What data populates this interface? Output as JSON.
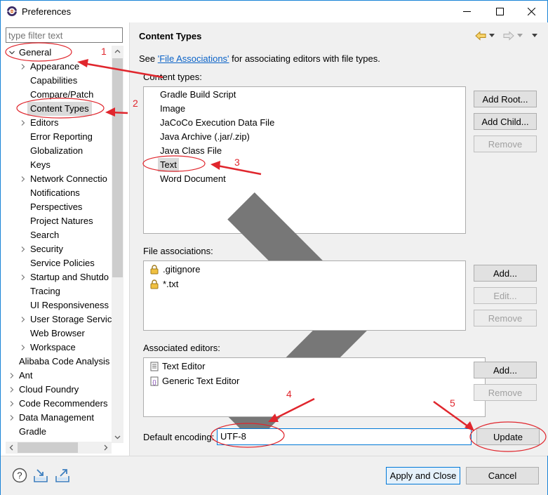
{
  "window": {
    "title": "Preferences",
    "controls": {
      "minimize": "minimize-icon",
      "maximize": "maximize-icon",
      "close": "close-icon"
    }
  },
  "filter": {
    "placeholder": "type filter text",
    "value": ""
  },
  "tree": {
    "items": [
      {
        "label": "General",
        "level": 0,
        "expander": "expanded"
      },
      {
        "label": "Appearance",
        "level": 1,
        "expander": "collapsed"
      },
      {
        "label": "Capabilities",
        "level": 1,
        "expander": "none"
      },
      {
        "label": "Compare/Patch",
        "level": 1,
        "expander": "none"
      },
      {
        "label": "Content Types",
        "level": 1,
        "expander": "none",
        "selected": true
      },
      {
        "label": "Editors",
        "level": 1,
        "expander": "collapsed"
      },
      {
        "label": "Error Reporting",
        "level": 1,
        "expander": "none"
      },
      {
        "label": "Globalization",
        "level": 1,
        "expander": "none"
      },
      {
        "label": "Keys",
        "level": 1,
        "expander": "none"
      },
      {
        "label": "Network Connectio",
        "level": 1,
        "expander": "collapsed"
      },
      {
        "label": "Notifications",
        "level": 1,
        "expander": "none"
      },
      {
        "label": "Perspectives",
        "level": 1,
        "expander": "none"
      },
      {
        "label": "Project Natures",
        "level": 1,
        "expander": "none"
      },
      {
        "label": "Search",
        "level": 1,
        "expander": "none"
      },
      {
        "label": "Security",
        "level": 1,
        "expander": "collapsed"
      },
      {
        "label": "Service Policies",
        "level": 1,
        "expander": "none"
      },
      {
        "label": "Startup and Shutdo",
        "level": 1,
        "expander": "collapsed"
      },
      {
        "label": "Tracing",
        "level": 1,
        "expander": "none"
      },
      {
        "label": "UI Responsiveness",
        "level": 1,
        "expander": "none"
      },
      {
        "label": "User Storage Servic",
        "level": 1,
        "expander": "collapsed"
      },
      {
        "label": "Web Browser",
        "level": 1,
        "expander": "none"
      },
      {
        "label": "Workspace",
        "level": 1,
        "expander": "collapsed"
      },
      {
        "label": "Alibaba Code Analysis",
        "level": 0,
        "expander": "none"
      },
      {
        "label": "Ant",
        "level": 0,
        "expander": "collapsed"
      },
      {
        "label": "Cloud Foundry",
        "level": 0,
        "expander": "collapsed"
      },
      {
        "label": "Code Recommenders",
        "level": 0,
        "expander": "collapsed"
      },
      {
        "label": "Data Management",
        "level": 0,
        "expander": "collapsed"
      },
      {
        "label": "Gradle",
        "level": 0,
        "expander": "none"
      }
    ]
  },
  "page": {
    "title": "Content Types",
    "desc_prefix": "See ",
    "desc_link": "'File Associations'",
    "desc_suffix": " for associating editors with file types.",
    "content_types_label": "Content types:",
    "content_types": [
      {
        "label": "Gradle Build Script",
        "expander": "none"
      },
      {
        "label": "Image",
        "expander": "none"
      },
      {
        "label": "JaCoCo Execution Data File",
        "expander": "none"
      },
      {
        "label": "Java Archive (.jar/.zip)",
        "expander": "none"
      },
      {
        "label": "Java Class File",
        "expander": "none"
      },
      {
        "label": "Text",
        "expander": "collapsed",
        "selected": true
      },
      {
        "label": "Word Document",
        "expander": "none"
      }
    ],
    "file_assoc_label": "File associations:",
    "file_associations": [
      {
        "label": ".gitignore",
        "icon": "lock-icon"
      },
      {
        "label": "*.txt",
        "icon": "lock-icon"
      }
    ],
    "editors_label": "Associated editors:",
    "editors": [
      {
        "label": "Text Editor",
        "icon": "text-editor-icon"
      },
      {
        "label": "Generic Text Editor",
        "icon": "generic-editor-icon"
      }
    ],
    "encoding_label": "Default encoding:",
    "encoding_value": "UTF-8",
    "buttons": {
      "add_root": "Add Root...",
      "add_child": "Add Child...",
      "remove1": "Remove",
      "add_assoc": "Add...",
      "edit_assoc": "Edit...",
      "remove_assoc": "Remove",
      "add_editor": "Add...",
      "remove_editor": "Remove",
      "update": "Update"
    }
  },
  "bottom": {
    "apply_close": "Apply and Close",
    "cancel": "Cancel",
    "icons": [
      "help-icon",
      "import-icon",
      "export-icon"
    ]
  },
  "annotations": [
    "1",
    "2",
    "3",
    "4",
    "5"
  ],
  "colors": {
    "accent": "#0078d7",
    "annotation": "#e0262d",
    "link": "#0a62c7",
    "selection": "#cce8ff"
  }
}
